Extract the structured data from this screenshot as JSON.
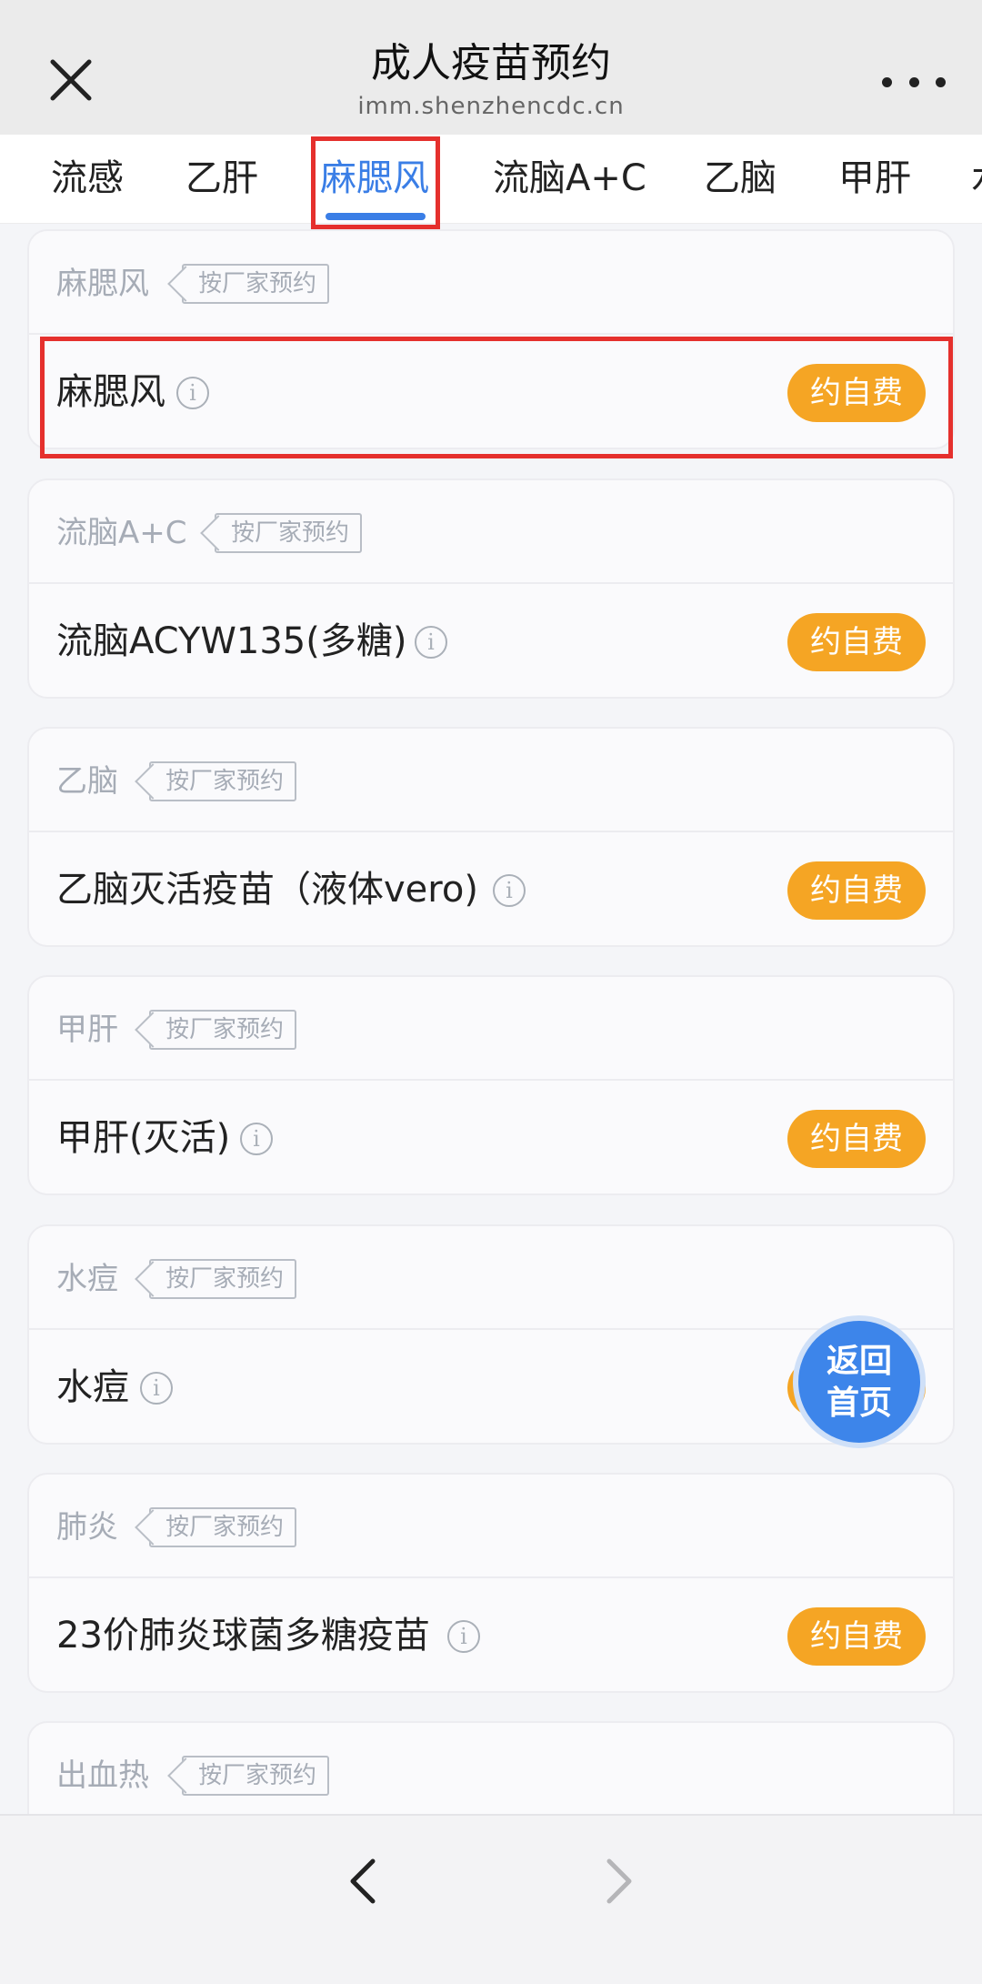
{
  "header": {
    "title": "成人疫苗预约",
    "subtitle": "imm.shenzhencdc.cn"
  },
  "tabs": [
    {
      "label": "流感"
    },
    {
      "label": "乙肝"
    },
    {
      "label": "麻腮风"
    },
    {
      "label": "流脑A+C"
    },
    {
      "label": "乙脑"
    },
    {
      "label": "甲肝"
    },
    {
      "label": "水"
    }
  ],
  "active_tab": "麻腮风",
  "tag_label": "按厂家预约",
  "book_label": "约自费",
  "cards": [
    {
      "category": "麻腮风",
      "vaccine": "麻腮风"
    },
    {
      "category": "流脑A+C",
      "vaccine": "流脑ACYW135(多糖)"
    },
    {
      "category": "乙脑",
      "vaccine": "乙脑灭活疫苗（液体vero)"
    },
    {
      "category": "甲肝",
      "vaccine": "甲肝(灭活)"
    },
    {
      "category": "水痘",
      "vaccine": "水痘"
    },
    {
      "category": "肺炎",
      "vaccine": "23价肺炎球菌多糖疫苗"
    },
    {
      "category": "出血热",
      "vaccine": ""
    }
  ],
  "float_button": {
    "line1": "返回",
    "line2": "首页"
  },
  "info_glyph": "i",
  "icons": {
    "close": "close-icon",
    "more": "more-icon",
    "back": "chevron-left-icon",
    "forward": "chevron-right-icon"
  },
  "colors": {
    "accent": "#3a7ee6",
    "book_button": "#f5a524",
    "highlight": "#e5302d"
  }
}
